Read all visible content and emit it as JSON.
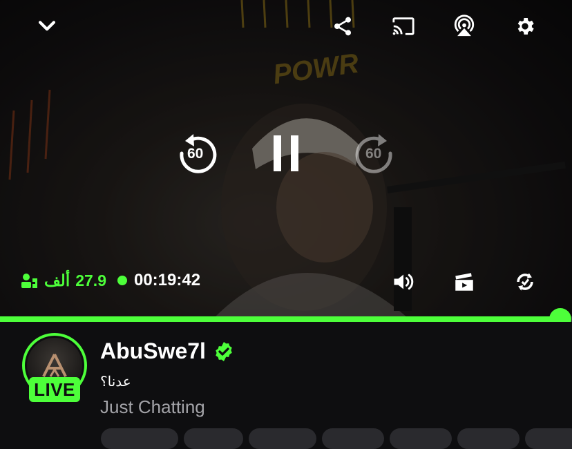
{
  "player": {
    "top_controls": [
      {
        "icon": "chevron-down-icon"
      },
      {
        "icon": "share-icon"
      },
      {
        "icon": "cast-icon"
      },
      {
        "icon": "airplay-icon"
      },
      {
        "icon": "gear-icon"
      }
    ],
    "rewind_seconds": "60",
    "forward_seconds": "60",
    "viewers": {
      "count": "27.9",
      "unit": "ألف"
    },
    "elapsed_time": "00:19:42",
    "bottom_controls": [
      {
        "icon": "volume-icon"
      },
      {
        "icon": "clip-icon"
      },
      {
        "icon": "rotate-icon"
      }
    ],
    "progress": 0.98,
    "background_sign": "POWR"
  },
  "channel": {
    "name": "AbuSwe7l",
    "verified": true,
    "live_label": "LIVE",
    "stream_title": "عدنا؟",
    "category": "Just Chatting"
  },
  "colors": {
    "accent": "#4dff3a",
    "background": "#0e0e10",
    "muted_text": "#a3a3a8",
    "verified": "#4dff3a"
  }
}
